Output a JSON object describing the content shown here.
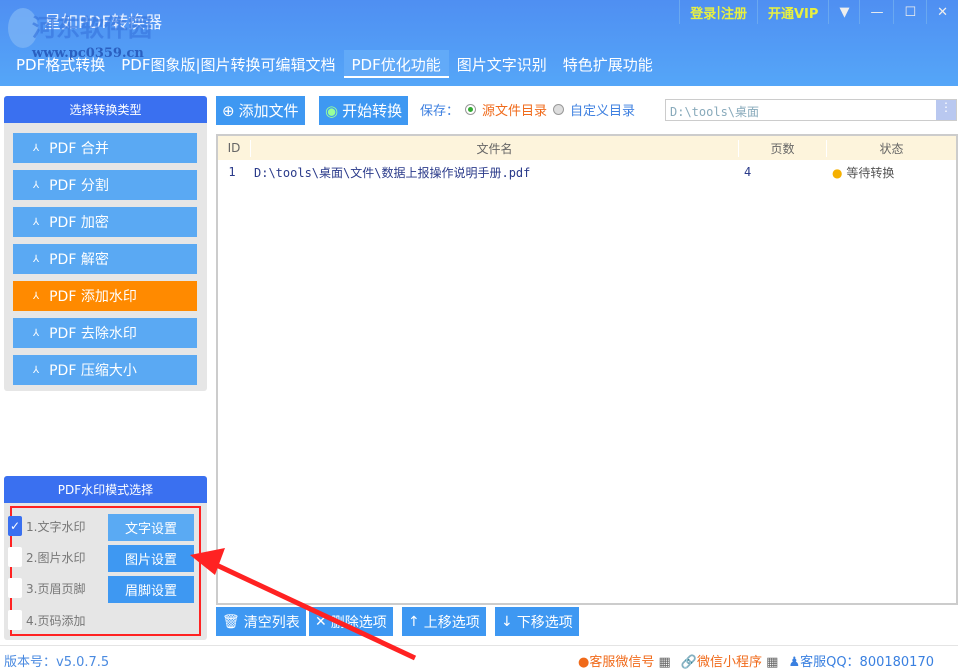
{
  "app": {
    "title": "星如PDF转换器",
    "watermark": "河东软件园",
    "watermark_url": "www.pc0359.cn"
  },
  "window_controls": {
    "login": "登录",
    "register": "注册",
    "vip": "开通VIP"
  },
  "tabs": [
    "PDF格式转换",
    "PDF图象版|图片转换可编辑文档",
    "PDF优化功能",
    "图片文字识别",
    "特色扩展功能"
  ],
  "left": {
    "header": "选择转换类型",
    "items": [
      "PDF 合并",
      "PDF 分割",
      "PDF 加密",
      "PDF 解密",
      "PDF 添加水印",
      "PDF 去除水印",
      "PDF 压缩大小"
    ],
    "active": 4
  },
  "watermark_mode": {
    "header": "PDF水印模式选择",
    "options": [
      {
        "label": "1.文字水印",
        "checked": true,
        "button": "文字设置"
      },
      {
        "label": "2.图片水印",
        "checked": false,
        "button": "图片设置"
      },
      {
        "label": "3.页眉页脚",
        "checked": false,
        "button": "眉脚设置"
      },
      {
        "label": "4.页码添加",
        "checked": false
      }
    ]
  },
  "toolbar": {
    "add_file": "添加文件",
    "start": "开始转换",
    "save_label": "保存：",
    "source_dir": "源文件目录",
    "custom_dir": "自定义目录",
    "path": "D:\\tools\\桌面"
  },
  "table": {
    "headers": [
      "ID",
      "文件名",
      "页数",
      "状态"
    ],
    "rows": [
      {
        "id": "1",
        "file": "D:\\tools\\桌面\\文件\\数据上报操作说明手册.pdf",
        "pages": "4",
        "status": "等待转换"
      }
    ]
  },
  "bottom_buttons": [
    "清空列表",
    "删除选项",
    "上移选项",
    "下移选项"
  ],
  "status": {
    "version": "版本号：v5.0.7.5",
    "wechat": "客服微信号",
    "mini": "微信小程序",
    "qq": "客服QQ：800180170"
  },
  "colors": {
    "accent": "#3e98f2",
    "active": "#ff8a00",
    "highlight": "#ff2222"
  }
}
